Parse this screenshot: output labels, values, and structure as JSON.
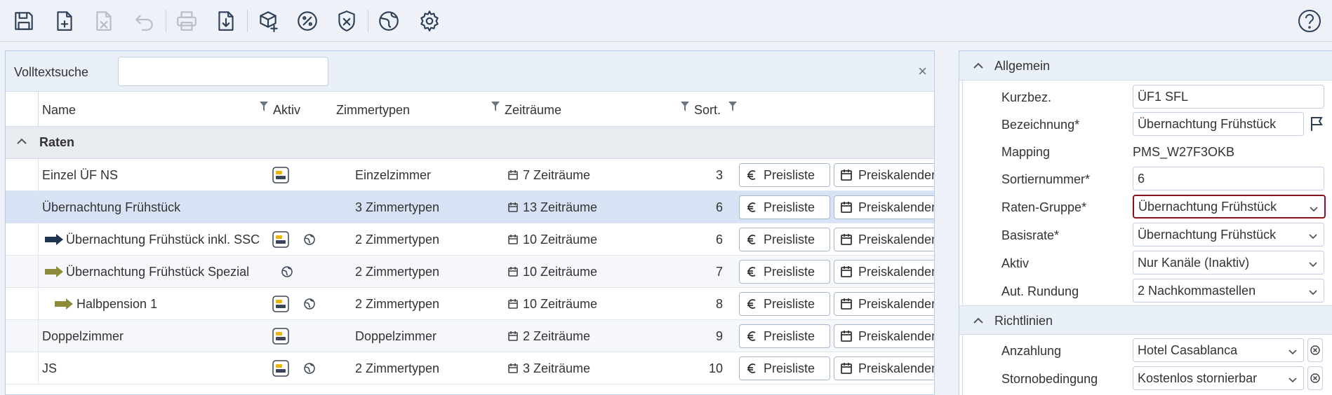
{
  "toolbar": {
    "icons": [
      "save-icon",
      "new-document-icon",
      "delete-document-icon",
      "undo-icon",
      "print-icon",
      "download-icon",
      "box-plus-icon",
      "percent-badge-icon",
      "shield-x-icon",
      "globe-icon",
      "gear-icon",
      "help-icon"
    ]
  },
  "search": {
    "label": "Volltextsuche",
    "value": "",
    "placeholder": "",
    "clear": "×"
  },
  "table": {
    "columns": {
      "name": "Name",
      "aktiv": "Aktiv",
      "zimmertypen": "Zimmertypen",
      "zeitraeume": "Zeiträume",
      "sort": "Sort."
    },
    "group": "Raten",
    "rows": [
      {
        "name": "Einzel ÜF NS",
        "zimmertypen": "Einzelzimmer",
        "zeitraeume": "7 Zeiträume",
        "sort": "3",
        "preisliste": "Preisliste",
        "preiskalender": "Preiskalender"
      },
      {
        "name": "Übernachtung Frühstück",
        "zimmertypen": "3 Zimmertypen",
        "zeitraeume": "13 Zeiträume",
        "sort": "6",
        "preisliste": "Preisliste",
        "preiskalender": "Preiskalender"
      },
      {
        "name": "Übernachtung Frühstück inkl. SSC",
        "zimmertypen": "2 Zimmertypen",
        "zeitraeume": "10 Zeiträume",
        "sort": "6",
        "preisliste": "Preisliste",
        "preiskalender": "Preiskalender"
      },
      {
        "name": "Übernachtung Frühstück Spezial",
        "zimmertypen": "2 Zimmertypen",
        "zeitraeume": "10 Zeiträume",
        "sort": "7",
        "preisliste": "Preisliste",
        "preiskalender": "Preiskalender"
      },
      {
        "name": "Halbpension 1",
        "zimmertypen": "2 Zimmertypen",
        "zeitraeume": "10 Zeiträume",
        "sort": "8",
        "preisliste": "Preisliste",
        "preiskalender": "Preiskalender"
      },
      {
        "name": "Doppelzimmer",
        "zimmertypen": "Doppelzimmer",
        "zeitraeume": "2 Zeiträume",
        "sort": "9",
        "preisliste": "Preisliste",
        "preiskalender": "Preiskalender"
      },
      {
        "name": "JS",
        "zimmertypen": "2 Zimmertypen",
        "zeitraeume": "3 Zeiträume",
        "sort": "10",
        "preisliste": "Preisliste",
        "preiskalender": "Preiskalender"
      }
    ]
  },
  "form": {
    "allgemein": {
      "title": "Allgemein",
      "kurzbez_label": "Kurzbez.",
      "kurzbez_value": "ÜF1 SFL",
      "bezeichnung_label": "Bezeichnung*",
      "bezeichnung_value": "Übernachtung Frühstück",
      "mapping_label": "Mapping",
      "mapping_value": "PMS_W27F3OKB",
      "sortiernummer_label": "Sortiernummer*",
      "sortiernummer_value": "6",
      "ratengruppe_label": "Raten-Gruppe*",
      "ratengruppe_value": "Übernachtung Frühstück",
      "basisrate_label": "Basisrate*",
      "basisrate_value": "Übernachtung Frühstück",
      "aktiv_label": "Aktiv",
      "aktiv_value": "Nur Kanäle (Inaktiv)",
      "rundung_label": "Aut. Rundung",
      "rundung_value": "2 Nachkommastellen"
    },
    "richtlinien": {
      "title": "Richtlinien",
      "anzahlung_label": "Anzahlung",
      "anzahlung_value": "Hotel Casablanca",
      "storno_label": "Stornobedingung",
      "storno_value": "Kostenlos stornierbar"
    }
  },
  "colors": {
    "accent_focus": "#8b1020",
    "arrow_dark": "#1e3450",
    "arrow_olive": "#8d8a3a",
    "selected_row": "#d7e3f4"
  }
}
